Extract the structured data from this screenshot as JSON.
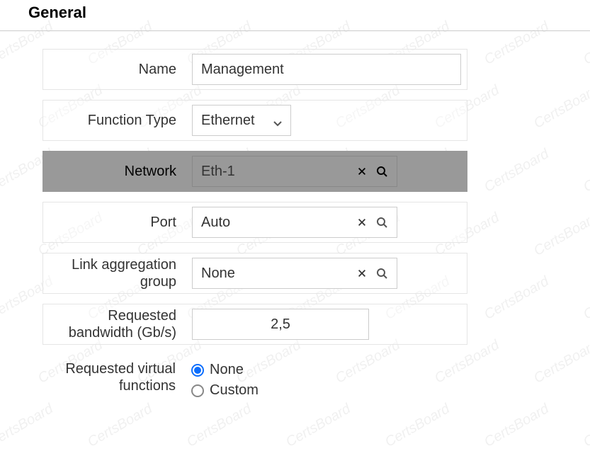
{
  "watermark_text": "CertsBoard",
  "section_title": "General",
  "form": {
    "name": {
      "label": "Name",
      "value": "Management"
    },
    "function_type": {
      "label": "Function Type",
      "value": "Ethernet"
    },
    "network": {
      "label": "Network",
      "value": "Eth-1"
    },
    "port": {
      "label": "Port",
      "value": "Auto"
    },
    "lag": {
      "label": "Link aggregation group",
      "value": "None"
    },
    "bandwidth": {
      "label": "Requested bandwidth (Gb/s)",
      "value": "2,5"
    },
    "virtual_funcs": {
      "label": "Requested virtual functions",
      "options": {
        "none": "None",
        "custom": "Custom"
      },
      "selected": "none"
    }
  }
}
